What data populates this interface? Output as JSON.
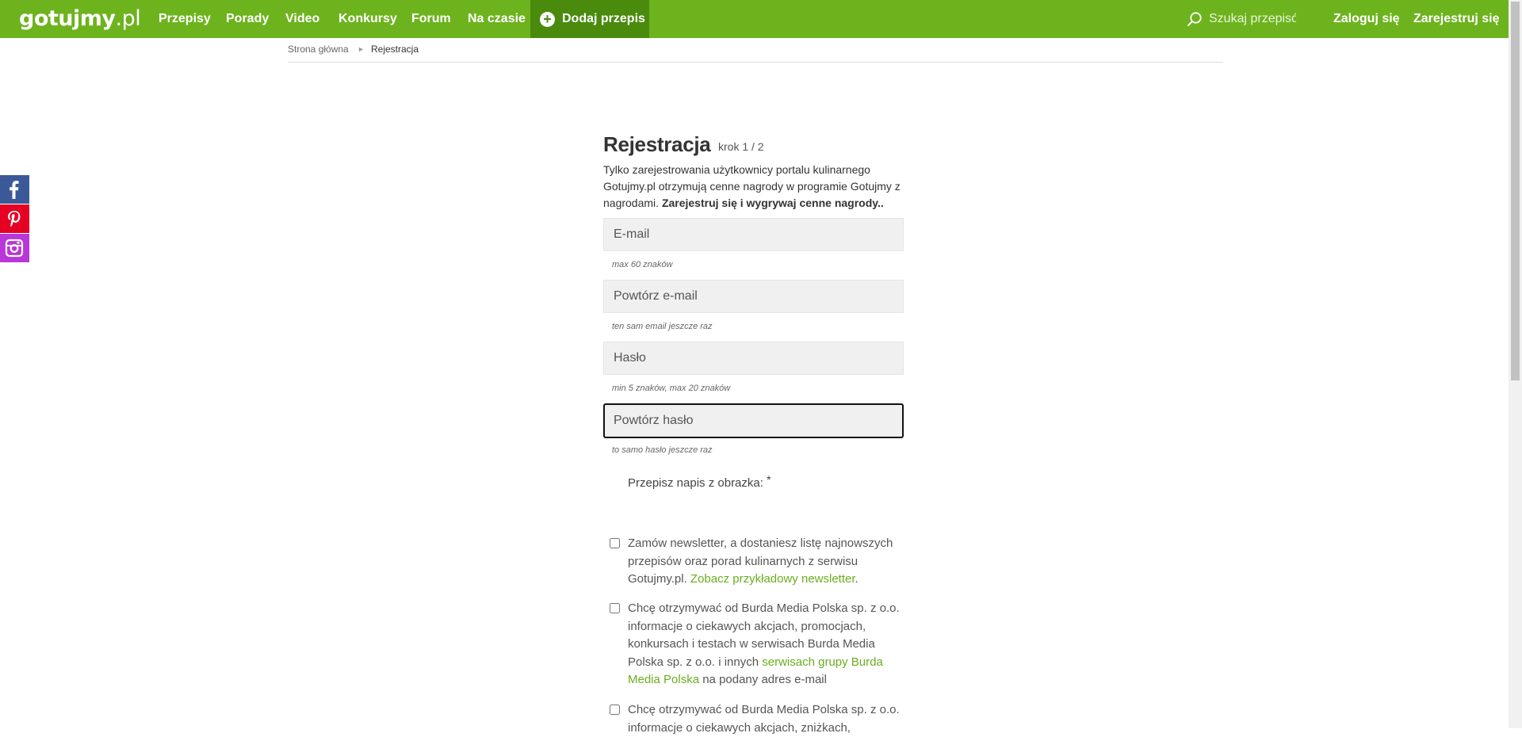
{
  "nav": {
    "logo_main": "gotujmy",
    "logo_suffix": ".pl",
    "items": [
      "Przepisy",
      "Porady",
      "Video",
      "Konkursy",
      "Forum",
      "Na czasie"
    ],
    "add_recipe": "Dodaj przepis",
    "search_placeholder": "Szukaj przepisów",
    "login": "Zaloguj się",
    "register": "Zarejestruj się",
    "brand_color": "#6db31d"
  },
  "breadcrumb": {
    "home": "Strona główna",
    "separator": "►",
    "current": "Rejestracja"
  },
  "social": [
    "facebook-icon",
    "pinterest-icon",
    "instagram-icon"
  ],
  "form": {
    "title": "Rejestracja",
    "step": "krok 1 / 2",
    "intro_text": "Tylko zarejestrowania użytkownicy portalu kulinarnego Gotujmy.pl otrzymują cenne nagrody w programie Gotujmy z nagrodami. ",
    "intro_bold": "Zarejestruj się i wygrywaj cenne nagrody..",
    "email_placeholder": "E-mail",
    "email_hint": "max 60 znaków",
    "email_repeat_placeholder": "Powtórz e-mail",
    "email_repeat_hint": "ten sam email jeszcze raz",
    "password_placeholder": "Hasło",
    "password_hint": "min 5 znaków, max 20 znaków",
    "password_repeat_placeholder": "Powtórz hasło",
    "password_repeat_hint": "to samo hasło jeszcze raz",
    "captcha_label": "Przepisz napis z obrazka:",
    "captcha_required": "*",
    "consents": [
      {
        "text": "Zamów newsletter, a dostaniesz listę najnowszych przepisów oraz porad kulinarnych z serwisu Gotujmy.pl. ",
        "link": "Zobacz przykładowy newsletter",
        "after": "."
      },
      {
        "text": "Chcę otrzymywać od Burda Media Polska sp. z o.o. informacje o ciekawych akcjach, promocjach, konkursach i testach w serwisach Burda Media Polska sp. z o.o. i innych ",
        "link": "serwisach grupy Burda Media Polska",
        "after": " na podany adres e-mail"
      },
      {
        "text": "Chcę otrzymywać od Burda Media Polska sp. z o.o. informacje o ciekawych akcjach, zniżkach,",
        "link": "",
        "after": ""
      }
    ]
  }
}
